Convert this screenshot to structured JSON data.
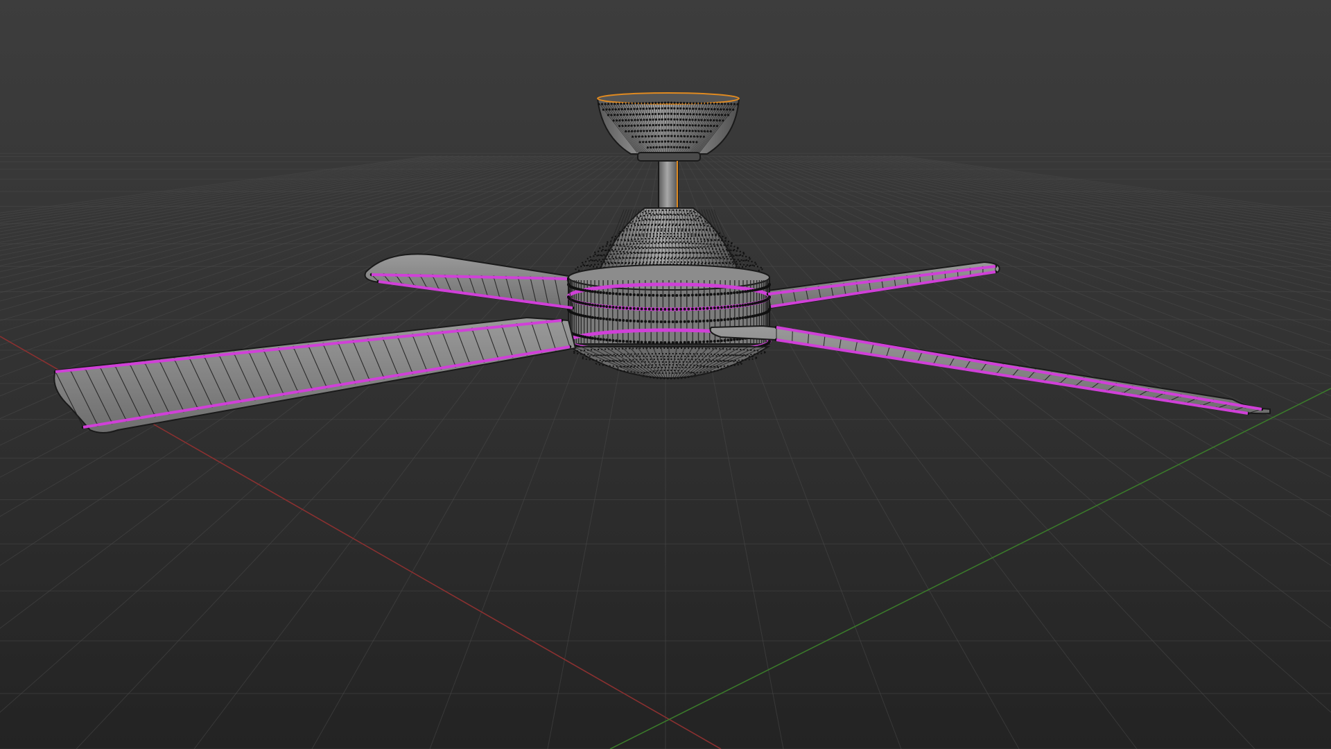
{
  "viewport": {
    "view": "3d-perspective",
    "mode": "edit-mesh",
    "object": "ceiling-fan",
    "blade_count": 4,
    "grid_visible": true,
    "axes_visible": [
      "x",
      "y"
    ]
  },
  "colors": {
    "background_top": "#3d3d3d",
    "background_bottom": "#232323",
    "grid_line": "#4a4a4a",
    "x_axis": "#8a3030",
    "y_axis": "#3a7a2a",
    "mesh_face": "#8a8a8a",
    "mesh_face_dark": "#5c5c5c",
    "vertex": "#111111",
    "edge_wire": "#202020",
    "selected_edge": "#d040d8",
    "active_outline": "#e08a20"
  },
  "icons": {
    "object": "ceiling-fan-mesh-icon"
  }
}
